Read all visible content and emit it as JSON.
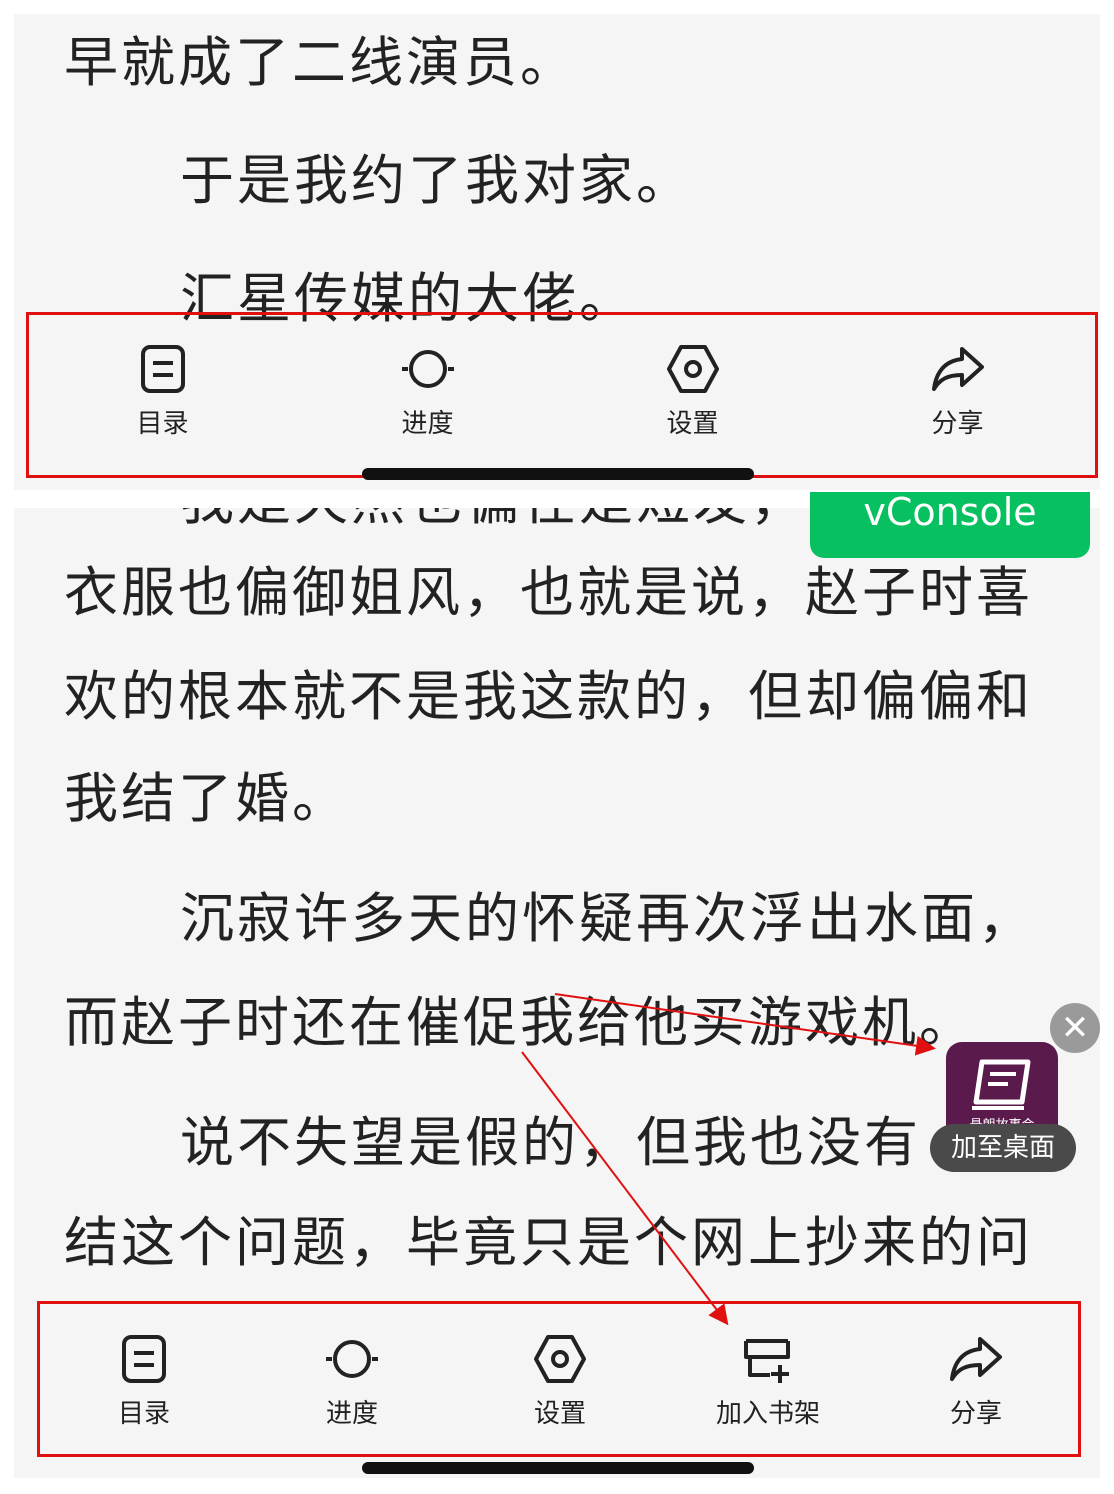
{
  "top_panel": {
    "lines": [
      "早就成了二线演员。",
      "于是我约了我对家。",
      "汇星传媒的大佬。"
    ],
    "toolbar": [
      {
        "label": "目录",
        "icon": "catalog-icon"
      },
      {
        "label": "进度",
        "icon": "progress-icon"
      },
      {
        "label": "设置",
        "icon": "settings-icon"
      },
      {
        "label": "分享",
        "icon": "share-icon"
      }
    ]
  },
  "bottom_panel": {
    "partial_line": "我是天然也偏在是短发，",
    "lines": [
      "衣服也偏御姐风，也就是说，赵子时喜",
      "欢的根本就不是我这款的，但却偏偏和",
      "我结了婚。",
      "沉寂许多天的怀疑再次浮出水面，",
      "而赵子时还在催促我给他买游戏机。",
      "说不失望是假的，但我也没有",
      "结这个问题，毕竟只是个网上抄来的问"
    ],
    "toolbar": [
      {
        "label": "目录",
        "icon": "catalog-icon"
      },
      {
        "label": "进度",
        "icon": "progress-icon"
      },
      {
        "label": "设置",
        "icon": "settings-icon"
      },
      {
        "label": "加入书架",
        "icon": "add-bookshelf-icon"
      },
      {
        "label": "分享",
        "icon": "share-icon"
      }
    ]
  },
  "vconsole_label": "vConsole",
  "floating": {
    "close_symbol": "✕",
    "app_name": "悬朗故事会",
    "add_to_desktop": "加至桌面"
  },
  "colors": {
    "annotation_red": "#e01010",
    "vconsole_green": "#07c160",
    "page_bg": "#f5f5f5",
    "app_tile_purple": "#5a1a4c"
  }
}
